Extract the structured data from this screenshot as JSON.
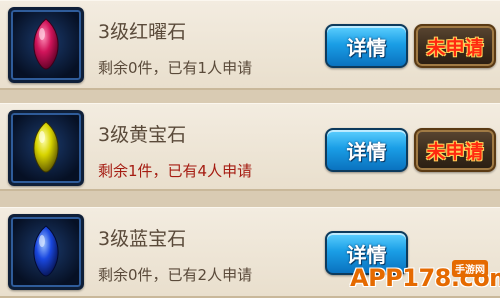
{
  "items": [
    {
      "name": "3级红曜石",
      "status": "剩余0件，已有1人申请",
      "status_highlight": false,
      "gem_color": "#d0145a",
      "gem_icon": "red-gem-icon",
      "detail_label": "详情",
      "apply_label": "未申请"
    },
    {
      "name": "3级黄宝石",
      "status": "剩余1件，已有4人申请",
      "status_highlight": true,
      "gem_color": "#e2e000",
      "gem_icon": "yellow-gem-icon",
      "detail_label": "详情",
      "apply_label": "未申请"
    },
    {
      "name": "3级蓝宝石",
      "status": "剩余0件，已有2人申请",
      "status_highlight": false,
      "gem_color": "#1a48e0",
      "gem_icon": "blue-gem-icon",
      "detail_label": "详情",
      "apply_label": ""
    }
  ],
  "watermark": {
    "site": "APP178.com",
    "badge": "手游网"
  }
}
